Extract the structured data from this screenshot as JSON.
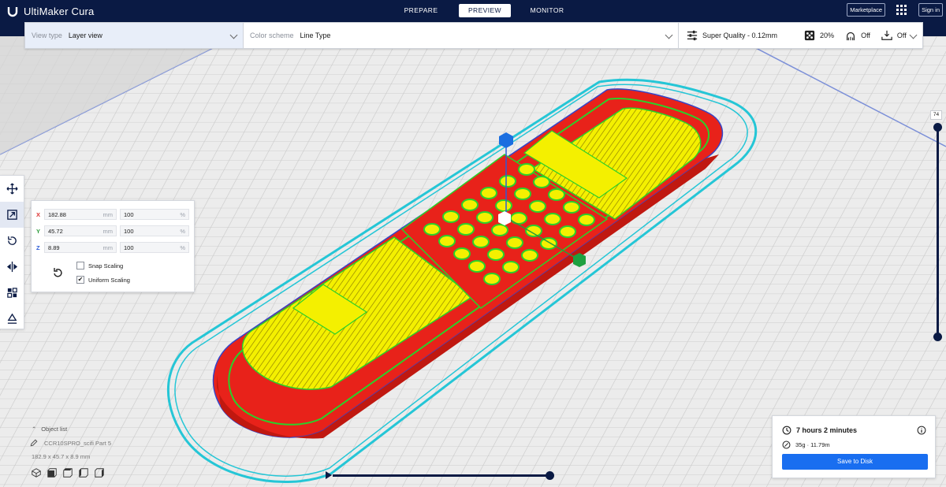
{
  "app": {
    "title": "UltiMaker Cura"
  },
  "stages": [
    {
      "label": "PREPARE",
      "active": false
    },
    {
      "label": "PREVIEW",
      "active": true
    },
    {
      "label": "MONITOR",
      "active": false
    }
  ],
  "top_right": {
    "marketplace": "Marketplace",
    "signin": "Sign in"
  },
  "view_type": {
    "label": "View type",
    "value": "Layer view"
  },
  "color_scheme": {
    "label": "Color scheme",
    "value": "Line Type"
  },
  "print_settings": {
    "profile": "Super Quality - 0.12mm",
    "infill": "20%",
    "support": "Off",
    "adhesion": "Off"
  },
  "scale": {
    "x": {
      "axis": "X",
      "value": "182.88",
      "unit": "mm",
      "percent": "100",
      "percent_unit": "%"
    },
    "y": {
      "axis": "Y",
      "value": "45.72",
      "unit": "mm",
      "percent": "100",
      "percent_unit": "%"
    },
    "z": {
      "axis": "Z",
      "value": "8.89",
      "unit": "mm",
      "percent": "100",
      "percent_unit": "%"
    },
    "snap_scaling": {
      "label": "Snap Scaling",
      "checked": false
    },
    "uniform_scaling": {
      "label": "Uniform Scaling",
      "checked": true
    }
  },
  "layer_slider": {
    "top_layer": "74"
  },
  "object_list": {
    "title": "Object list",
    "item": "CCR10SPRO_scifi Part 5",
    "dimensions": "182.9 x 45.7 x 8.9 mm"
  },
  "summary": {
    "time": "7 hours 2 minutes",
    "material": "35g · 11.79m",
    "save_label": "Save to Disk"
  },
  "colors": {
    "accent": "#196ef0",
    "topbar": "#0a1a44",
    "wall_outer": "#e8221a",
    "wall_inner": "#2ad12a",
    "skin": "#f4f000",
    "skirt": "#25c6d6"
  },
  "icons": {
    "toolbar": [
      "move-icon",
      "scale-icon",
      "rotate-icon",
      "mirror-icon",
      "per-model-settings-icon",
      "support-blocker-icon"
    ]
  }
}
